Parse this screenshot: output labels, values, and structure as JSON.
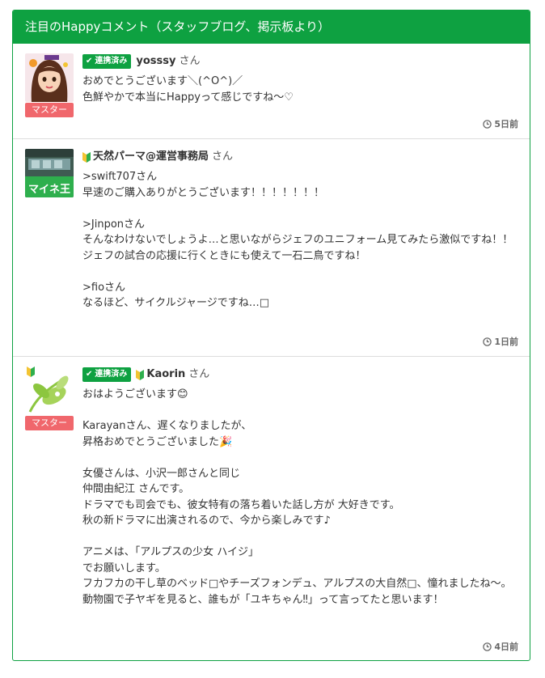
{
  "panel": {
    "title": "注目のHappyコメント（スタッフブログ、掲示板より）"
  },
  "colors": {
    "brand_green": "#0ea141",
    "master_badge": "#f0676c",
    "divider": "#dddddd"
  },
  "comments": [
    {
      "linked_badge": "連携済み",
      "username": "yosssy",
      "honorific": "さん",
      "master_badge": "マスター",
      "body": "おめでとうございます＼(^O^)／\n色鮮やかで本当にHappyって感じですね〜♡",
      "time": "5日前",
      "avatar_icon": "user-avatar-woman-icon"
    },
    {
      "username": "天然パーマ@運営事務局",
      "honorific": "さん",
      "body": ">swift707さん\n早速のご購入ありがとうございます！！！！！！！\n\n>Jinponさん\nそんなわけないでしょうよ…と思いながらジェフのユニフォーム見てみたら激似ですね！！\nジェフの試合の応援に行くときにも使えて一石二鳥ですね！\n\n>fioさん\nなるほど、サイクルジャージですね…□",
      "time": "1日前",
      "avatar_icon": "store-avatar-icon",
      "avatar_text": "マイネ王"
    },
    {
      "linked_badge": "連携済み",
      "username": "Kaorin",
      "honorific": "さん",
      "master_badge": "マスター",
      "body": "おはようございます😊\n\nKarayanさん、遅くなりましたが、\n昇格おめでとうございました🎉\n\n女優さんは、小沢一郎さんと同じ\n仲間由紀江 さんです。\nドラマでも司会でも、彼女特有の落ち着いた話し方が 大好きです。\n秋の新ドラマに出演されるので、今から楽しみです♪\n\nアニメは、「アルプスの少女 ハイジ」\nでお願いします。\nフカフカの干し草のベッド□やチーズフォンデュ、アルプスの大自然□、憧れましたね〜。\n動物園で子ヤギを見ると、誰もが「ユキちゃん‼」って言ってたと思います！",
      "time": "4日前",
      "avatar_icon": "leaf-avatar-icon"
    }
  ]
}
